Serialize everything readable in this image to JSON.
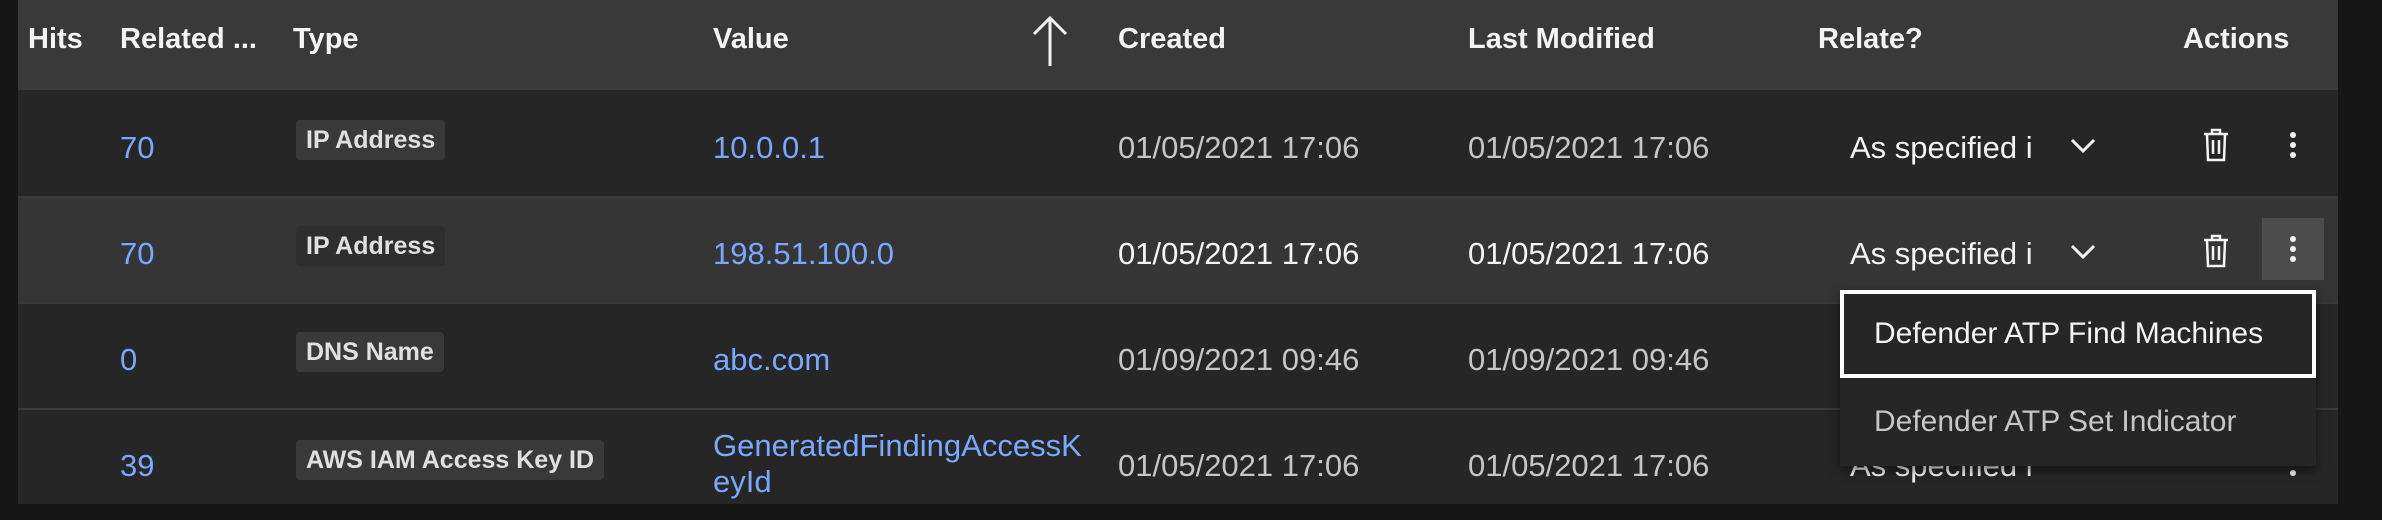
{
  "columns": {
    "hits": "Hits",
    "related": "Related ...",
    "type": "Type",
    "value": "Value",
    "created": "Created",
    "last_modified": "Last Modified",
    "relate": "Relate?",
    "actions": "Actions"
  },
  "sort": {
    "column": "Value",
    "direction": "ascending",
    "icon": "arrow-up-icon"
  },
  "rows": [
    {
      "related": "70",
      "type": "IP Address",
      "value": "10.0.0.1",
      "created": "01/05/2021 17:06",
      "modified": "01/05/2021 17:06",
      "relate": "As specified i"
    },
    {
      "related": "70",
      "type": "IP Address",
      "value": "198.51.100.0",
      "created": "01/05/2021 17:06",
      "modified": "01/05/2021 17:06",
      "relate": "As specified i"
    },
    {
      "related": "0",
      "type": "DNS Name",
      "value": "abc.com",
      "created": "01/09/2021 09:46",
      "modified": "01/09/2021 09:46",
      "relate": ""
    },
    {
      "related": "39",
      "type": "AWS IAM Access Key ID",
      "value_line1": "GeneratedFindingAccessK",
      "value_line2": "eyId",
      "created": "01/05/2021 17:06",
      "modified": "01/05/2021 17:06",
      "relate": "As specified i"
    }
  ],
  "overflow_menu": {
    "items": [
      {
        "label": "Defender ATP Find Machines",
        "focused": true
      },
      {
        "label": "Defender ATP Set Indicator",
        "focused": false
      }
    ]
  },
  "colors": {
    "link": "#78a9ff",
    "header_bg": "#393939",
    "row_bg": "#262626",
    "hover_bg": "#353535"
  }
}
